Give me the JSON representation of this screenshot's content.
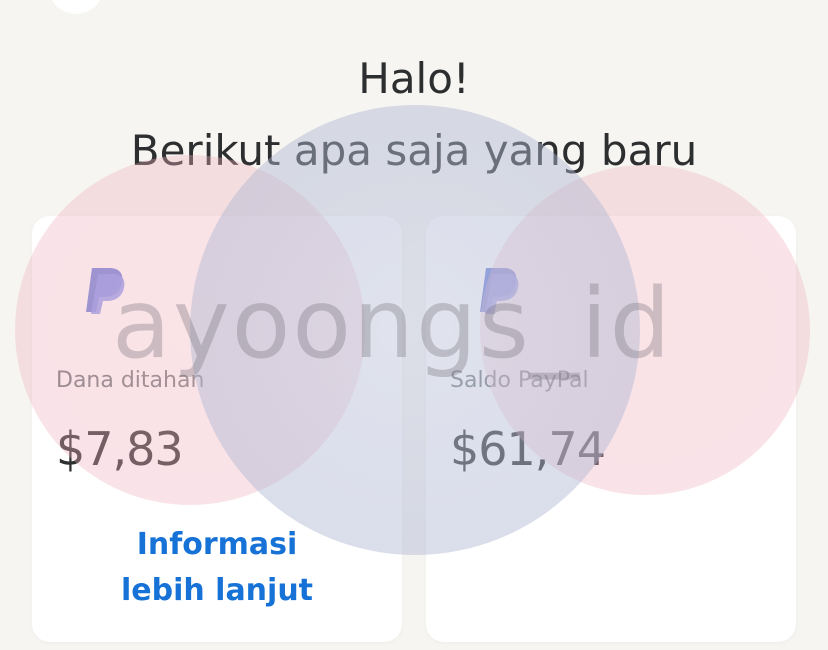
{
  "header": {
    "line1": "Halo!",
    "line2": "Berikut apa saja yang baru"
  },
  "cards": [
    {
      "label": "Dana ditahan",
      "amount": "$7,83",
      "link_line1": "Informasi",
      "link_line2": "lebih lanjut",
      "logo": "paypal-logo-icon"
    },
    {
      "label": "Saldo PayPal",
      "amount": "$61,74",
      "logo": "paypal-logo-icon"
    }
  ],
  "watermark": {
    "text": "ayoongs_id"
  },
  "colors": {
    "background": "#f6f5f1",
    "card": "#ffffff",
    "link": "#1672d6",
    "text": "#2c2e2f",
    "muted": "#6c7378",
    "paypal_dark": "#253b80",
    "paypal_light": "#179bd7"
  }
}
